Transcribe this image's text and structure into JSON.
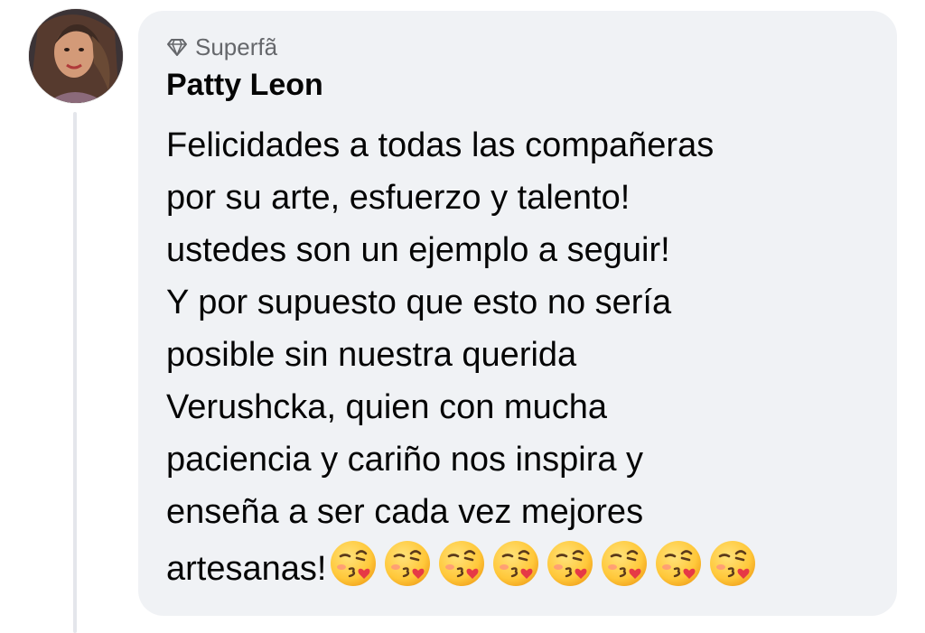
{
  "comment": {
    "badge": {
      "label": "Superfã",
      "icon": "diamond-icon"
    },
    "author": "Patty Leon",
    "text_lines": [
      "Felicidades a todas las compañeras",
      "por su arte, esfuerzo y talento!",
      "ustedes son un ejemplo a seguir!",
      "Y por supuesto que esto no sería",
      "posible sin nuestra querida",
      "Verushcka, quien con mucha",
      "paciencia y cariño nos inspira y",
      "enseña a ser cada vez mejores"
    ],
    "last_line_text": "artesanas!",
    "emojis": [
      "😘",
      "😘",
      "😘",
      "😘",
      "😘",
      "😘",
      "😘",
      "😘"
    ]
  },
  "colors": {
    "bubble_bg": "#f0f2f5",
    "text": "#050505",
    "muted": "#65676b",
    "thread_line": "#e4e6eb"
  }
}
